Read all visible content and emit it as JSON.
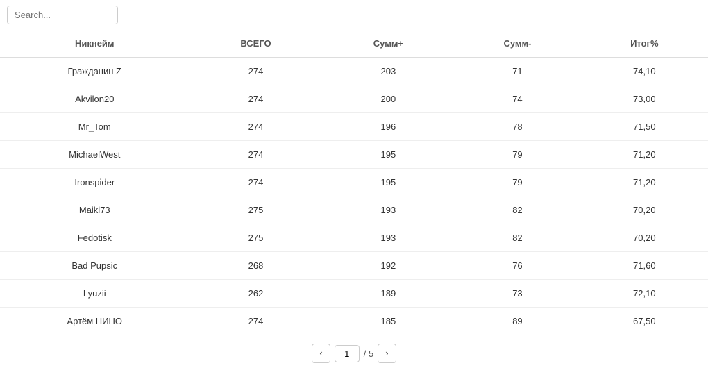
{
  "search": {
    "placeholder": "Search..."
  },
  "table": {
    "columns": [
      {
        "key": "nickname",
        "label": "Никнейм"
      },
      {
        "key": "total",
        "label": "ВСЕГО"
      },
      {
        "key": "sum_plus",
        "label": "Сумм+"
      },
      {
        "key": "sum_minus",
        "label": "Сумм-"
      },
      {
        "key": "result_pct",
        "label": "Итог%"
      }
    ],
    "rows": [
      {
        "nickname": "Гражданин Z",
        "total": "274",
        "sum_plus": "203",
        "sum_minus": "71",
        "result_pct": "74,10"
      },
      {
        "nickname": "Akvilon20",
        "total": "274",
        "sum_plus": "200",
        "sum_minus": "74",
        "result_pct": "73,00"
      },
      {
        "nickname": "Mr_Tom",
        "total": "274",
        "sum_plus": "196",
        "sum_minus": "78",
        "result_pct": "71,50"
      },
      {
        "nickname": "MichaelWest",
        "total": "274",
        "sum_plus": "195",
        "sum_minus": "79",
        "result_pct": "71,20"
      },
      {
        "nickname": "Ironspider",
        "total": "274",
        "sum_plus": "195",
        "sum_minus": "79",
        "result_pct": "71,20"
      },
      {
        "nickname": "Maikl73",
        "total": "275",
        "sum_plus": "193",
        "sum_minus": "82",
        "result_pct": "70,20"
      },
      {
        "nickname": "Fedotisk",
        "total": "275",
        "sum_plus": "193",
        "sum_minus": "82",
        "result_pct": "70,20"
      },
      {
        "nickname": "Bad Pupsic",
        "total": "268",
        "sum_plus": "192",
        "sum_minus": "76",
        "result_pct": "71,60"
      },
      {
        "nickname": "Lyuzii",
        "total": "262",
        "sum_plus": "189",
        "sum_minus": "73",
        "result_pct": "72,10"
      },
      {
        "nickname": "Артём НИНО",
        "total": "274",
        "sum_plus": "185",
        "sum_minus": "89",
        "result_pct": "67,50"
      }
    ]
  },
  "pagination": {
    "current_page": "1",
    "total_pages": "5",
    "prev_label": "‹",
    "next_label": "›",
    "separator": "/ "
  }
}
